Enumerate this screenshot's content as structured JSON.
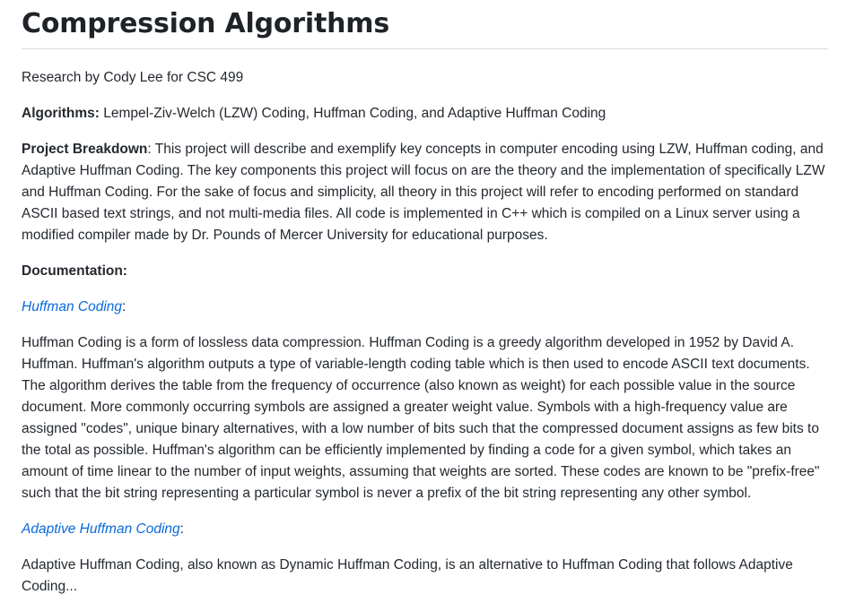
{
  "title": "Compression Algorithms",
  "byline": "Research by Cody Lee for CSC 499",
  "algorithms": {
    "label": "Algorithms:",
    "text": " Lempel-Ziv-Welch (LZW) Coding, Huffman Coding, and Adaptive Huffman Coding"
  },
  "breakdown": {
    "label": "Project Breakdown",
    "text": ": This project will describe and exemplify key concepts in computer encoding using LZW, Huffman coding, and Adaptive Huffman Coding. The key components this project will focus on are the theory and the implementation of specifically LZW and Huffman Coding. For the sake of focus and simplicity, all theory in this project will refer to encoding performed on standard ASCII based text strings, and not multi-media files. All code is implemented in C++ which is compiled on a Linux server using a modified compiler made by Dr. Pounds of Mercer University for educational purposes."
  },
  "documentation": {
    "label": "Documentation:"
  },
  "huffman": {
    "link": "Huffman Coding",
    "suffix": ":",
    "body": "Huffman Coding is a form of lossless data compression. Huffman Coding is a greedy algorithm developed in 1952 by David A. Huffman. Huffman's algorithm outputs a type of variable-length coding table which is then used to encode ASCII text documents. The algorithm derives the table from the frequency of occurrence (also known as weight) for each possible value in the source document. More commonly occurring symbols are assigned a greater weight value. Symbols with a high-frequency value are assigned \"codes\", unique binary alternatives, with a low number of bits such that the compressed document assigns as few bits to the total as possible. Huffman's algorithm can be efficiently implemented by finding a code for a given symbol, which takes an amount of time linear to the number of input weights, assuming that weights are sorted. These codes are known to be \"prefix-free\" such that the bit string representing a particular symbol is never a prefix of the bit string representing any other symbol."
  },
  "adaptive": {
    "link": "Adaptive Huffman Coding",
    "suffix": ":",
    "body": "Adaptive Huffman Coding, also known as Dynamic Huffman Coding, is an alternative to Huffman Coding that follows Adaptive Coding..."
  },
  "colors": {
    "link": "#0969da",
    "text": "#24292f",
    "rule": "#d8dee4"
  }
}
